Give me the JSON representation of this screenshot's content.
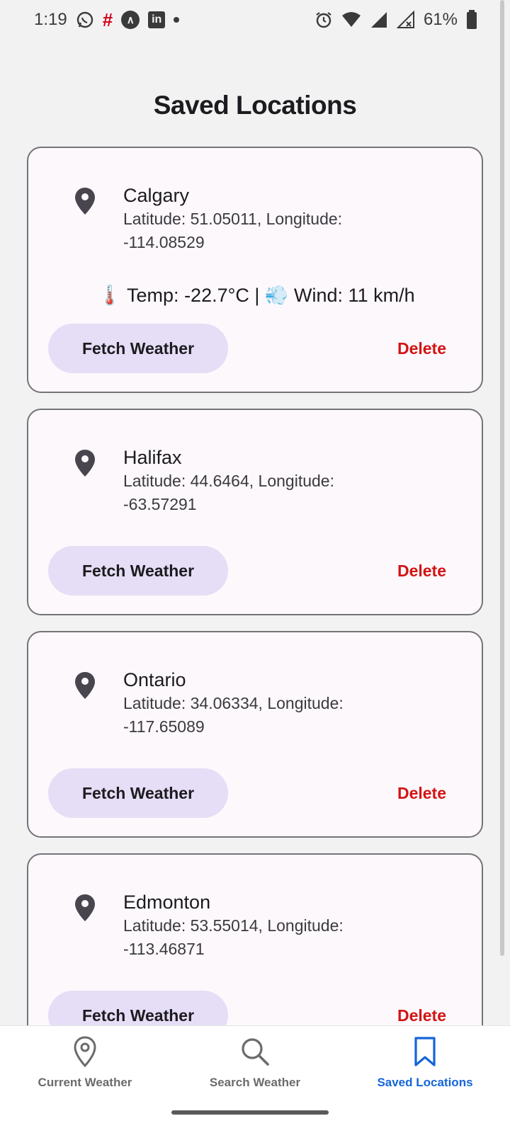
{
  "status_bar": {
    "time": "1:19",
    "battery": "61%",
    "icons_left": [
      "whatsapp-icon",
      "hashtag-icon",
      "arrow-up-icon",
      "linkedin-icon",
      "dot-icon"
    ],
    "icons_right": [
      "alarm-icon",
      "wifi-icon",
      "signal-icon",
      "signal-no-service-icon",
      "battery-icon"
    ]
  },
  "page": {
    "title": "Saved Locations"
  },
  "locations": [
    {
      "name": "Calgary",
      "coords": "Latitude: 51.05011, Longitude: -114.08529",
      "weather": "🌡️ Temp: -22.7°C | 💨 Wind: 11 km/h",
      "fetch_label": "Fetch Weather",
      "delete_label": "Delete"
    },
    {
      "name": "Halifax",
      "coords": "Latitude: 44.6464, Longitude: -63.57291",
      "fetch_label": "Fetch Weather",
      "delete_label": "Delete"
    },
    {
      "name": "Ontario",
      "coords": "Latitude: 34.06334, Longitude: -117.65089",
      "fetch_label": "Fetch Weather",
      "delete_label": "Delete"
    },
    {
      "name": "Edmonton",
      "coords": "Latitude: 53.55014, Longitude: -113.46871",
      "fetch_label": "Fetch Weather",
      "delete_label": "Delete"
    }
  ],
  "bottom_nav": {
    "items": [
      {
        "label": "Current Weather",
        "icon": "location-pin-icon",
        "active": false
      },
      {
        "label": "Search Weather",
        "icon": "search-icon",
        "active": false
      },
      {
        "label": "Saved Locations",
        "icon": "bookmark-icon",
        "active": true
      }
    ]
  },
  "colors": {
    "accent": "#1565d8",
    "delete": "#d21414",
    "button_bg": "#e6ddf6",
    "card_bg": "#fdf8fc"
  }
}
